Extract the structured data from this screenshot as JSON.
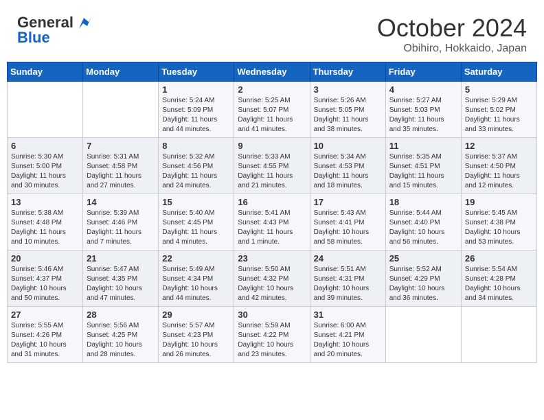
{
  "header": {
    "logo_general": "General",
    "logo_blue": "Blue",
    "month_title": "October 2024",
    "location": "Obihiro, Hokkaido, Japan"
  },
  "days_of_week": [
    "Sunday",
    "Monday",
    "Tuesday",
    "Wednesday",
    "Thursday",
    "Friday",
    "Saturday"
  ],
  "weeks": [
    [
      {
        "day": "",
        "info": ""
      },
      {
        "day": "",
        "info": ""
      },
      {
        "day": "1",
        "info": "Sunrise: 5:24 AM\nSunset: 5:09 PM\nDaylight: 11 hours and 44 minutes."
      },
      {
        "day": "2",
        "info": "Sunrise: 5:25 AM\nSunset: 5:07 PM\nDaylight: 11 hours and 41 minutes."
      },
      {
        "day": "3",
        "info": "Sunrise: 5:26 AM\nSunset: 5:05 PM\nDaylight: 11 hours and 38 minutes."
      },
      {
        "day": "4",
        "info": "Sunrise: 5:27 AM\nSunset: 5:03 PM\nDaylight: 11 hours and 35 minutes."
      },
      {
        "day": "5",
        "info": "Sunrise: 5:29 AM\nSunset: 5:02 PM\nDaylight: 11 hours and 33 minutes."
      }
    ],
    [
      {
        "day": "6",
        "info": "Sunrise: 5:30 AM\nSunset: 5:00 PM\nDaylight: 11 hours and 30 minutes."
      },
      {
        "day": "7",
        "info": "Sunrise: 5:31 AM\nSunset: 4:58 PM\nDaylight: 11 hours and 27 minutes."
      },
      {
        "day": "8",
        "info": "Sunrise: 5:32 AM\nSunset: 4:56 PM\nDaylight: 11 hours and 24 minutes."
      },
      {
        "day": "9",
        "info": "Sunrise: 5:33 AM\nSunset: 4:55 PM\nDaylight: 11 hours and 21 minutes."
      },
      {
        "day": "10",
        "info": "Sunrise: 5:34 AM\nSunset: 4:53 PM\nDaylight: 11 hours and 18 minutes."
      },
      {
        "day": "11",
        "info": "Sunrise: 5:35 AM\nSunset: 4:51 PM\nDaylight: 11 hours and 15 minutes."
      },
      {
        "day": "12",
        "info": "Sunrise: 5:37 AM\nSunset: 4:50 PM\nDaylight: 11 hours and 12 minutes."
      }
    ],
    [
      {
        "day": "13",
        "info": "Sunrise: 5:38 AM\nSunset: 4:48 PM\nDaylight: 11 hours and 10 minutes."
      },
      {
        "day": "14",
        "info": "Sunrise: 5:39 AM\nSunset: 4:46 PM\nDaylight: 11 hours and 7 minutes."
      },
      {
        "day": "15",
        "info": "Sunrise: 5:40 AM\nSunset: 4:45 PM\nDaylight: 11 hours and 4 minutes."
      },
      {
        "day": "16",
        "info": "Sunrise: 5:41 AM\nSunset: 4:43 PM\nDaylight: 11 hours and 1 minute."
      },
      {
        "day": "17",
        "info": "Sunrise: 5:43 AM\nSunset: 4:41 PM\nDaylight: 10 hours and 58 minutes."
      },
      {
        "day": "18",
        "info": "Sunrise: 5:44 AM\nSunset: 4:40 PM\nDaylight: 10 hours and 56 minutes."
      },
      {
        "day": "19",
        "info": "Sunrise: 5:45 AM\nSunset: 4:38 PM\nDaylight: 10 hours and 53 minutes."
      }
    ],
    [
      {
        "day": "20",
        "info": "Sunrise: 5:46 AM\nSunset: 4:37 PM\nDaylight: 10 hours and 50 minutes."
      },
      {
        "day": "21",
        "info": "Sunrise: 5:47 AM\nSunset: 4:35 PM\nDaylight: 10 hours and 47 minutes."
      },
      {
        "day": "22",
        "info": "Sunrise: 5:49 AM\nSunset: 4:34 PM\nDaylight: 10 hours and 44 minutes."
      },
      {
        "day": "23",
        "info": "Sunrise: 5:50 AM\nSunset: 4:32 PM\nDaylight: 10 hours and 42 minutes."
      },
      {
        "day": "24",
        "info": "Sunrise: 5:51 AM\nSunset: 4:31 PM\nDaylight: 10 hours and 39 minutes."
      },
      {
        "day": "25",
        "info": "Sunrise: 5:52 AM\nSunset: 4:29 PM\nDaylight: 10 hours and 36 minutes."
      },
      {
        "day": "26",
        "info": "Sunrise: 5:54 AM\nSunset: 4:28 PM\nDaylight: 10 hours and 34 minutes."
      }
    ],
    [
      {
        "day": "27",
        "info": "Sunrise: 5:55 AM\nSunset: 4:26 PM\nDaylight: 10 hours and 31 minutes."
      },
      {
        "day": "28",
        "info": "Sunrise: 5:56 AM\nSunset: 4:25 PM\nDaylight: 10 hours and 28 minutes."
      },
      {
        "day": "29",
        "info": "Sunrise: 5:57 AM\nSunset: 4:23 PM\nDaylight: 10 hours and 26 minutes."
      },
      {
        "day": "30",
        "info": "Sunrise: 5:59 AM\nSunset: 4:22 PM\nDaylight: 10 hours and 23 minutes."
      },
      {
        "day": "31",
        "info": "Sunrise: 6:00 AM\nSunset: 4:21 PM\nDaylight: 10 hours and 20 minutes."
      },
      {
        "day": "",
        "info": ""
      },
      {
        "day": "",
        "info": ""
      }
    ]
  ]
}
